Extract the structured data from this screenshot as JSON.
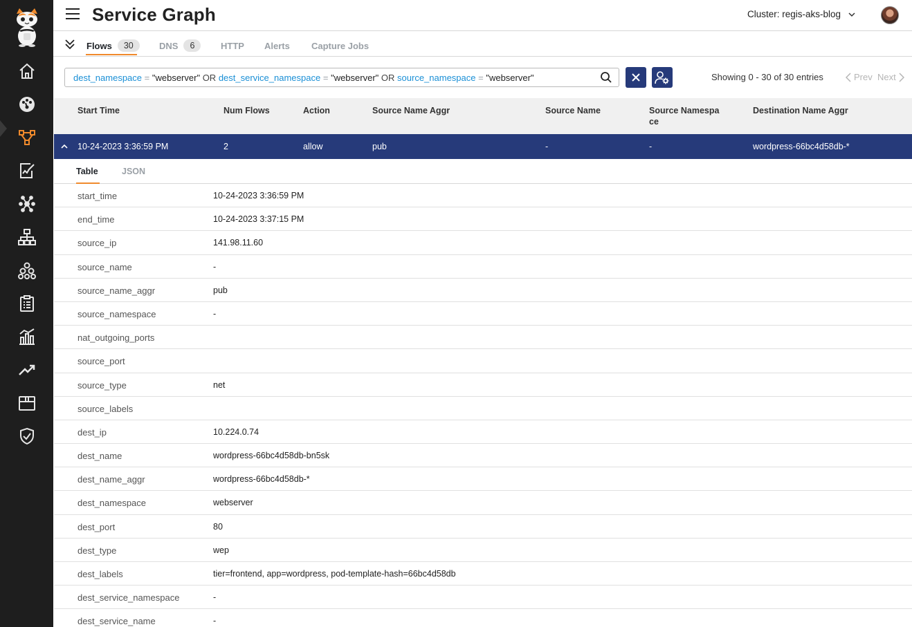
{
  "app": {
    "title": "Service Graph",
    "cluster_label": "Cluster: regis-aks-blog"
  },
  "sidebar": {
    "items": [
      {
        "icon": "home-icon"
      },
      {
        "icon": "dashboard-gauge-icon"
      },
      {
        "icon": "service-graph-icon",
        "active": true
      },
      {
        "icon": "policy-edit-icon"
      },
      {
        "icon": "network-nodes-icon"
      },
      {
        "icon": "hierarchy-icon"
      },
      {
        "icon": "cluster-nodes-icon"
      },
      {
        "icon": "clipboard-icon"
      },
      {
        "icon": "bar-chart-icon"
      },
      {
        "icon": "trend-up-icon"
      },
      {
        "icon": "box-icon"
      },
      {
        "icon": "shield-check-icon"
      }
    ]
  },
  "tabs": [
    {
      "label": "Flows",
      "count": "30",
      "active": true
    },
    {
      "label": "DNS",
      "count": "6"
    },
    {
      "label": "HTTP"
    },
    {
      "label": "Alerts"
    },
    {
      "label": "Capture Jobs"
    }
  ],
  "query": {
    "k1": "dest_namespace",
    "op": "=",
    "v1": "\"webserver\"",
    "b1": "OR",
    "k2": "dest_service_namespace",
    "v2": "\"webserver\"",
    "b2": "OR",
    "k3": "source_namespace",
    "v3": "\"webserver\""
  },
  "pagination": {
    "showing": "Showing 0 - 30 of 30 entries",
    "prev": "Prev",
    "next": "Next"
  },
  "table": {
    "columns": [
      "Start Time",
      "Num Flows",
      "Action",
      "Source Name Aggr",
      "Source Name",
      "Source Namespa ce",
      "Destination Name Aggr"
    ],
    "selected_row": [
      "10-24-2023 3:36:59 PM",
      "2",
      "allow",
      "pub",
      "-",
      "-",
      "wordpress-66bc4d58db-*"
    ]
  },
  "detail": {
    "subtabs": [
      "Table",
      "JSON"
    ],
    "rows": [
      {
        "key": "start_time",
        "value": "10-24-2023 3:36:59 PM"
      },
      {
        "key": "end_time",
        "value": "10-24-2023 3:37:15 PM"
      },
      {
        "key": "source_ip",
        "value": "141.98.11.60"
      },
      {
        "key": "source_name",
        "value": "-"
      },
      {
        "key": "source_name_aggr",
        "value": "pub"
      },
      {
        "key": "source_namespace",
        "value": "-"
      },
      {
        "key": "nat_outgoing_ports",
        "value": ""
      },
      {
        "key": "source_port",
        "value": ""
      },
      {
        "key": "source_type",
        "value": "net"
      },
      {
        "key": "source_labels",
        "value": ""
      },
      {
        "key": "dest_ip",
        "value": "10.224.0.74"
      },
      {
        "key": "dest_name",
        "value": "wordpress-66bc4d58db-bn5sk"
      },
      {
        "key": "dest_name_aggr",
        "value": "wordpress-66bc4d58db-*"
      },
      {
        "key": "dest_namespace",
        "value": "webserver"
      },
      {
        "key": "dest_port",
        "value": "80"
      },
      {
        "key": "dest_type",
        "value": "wep"
      },
      {
        "key": "dest_labels",
        "value": "tier=frontend, app=wordpress, pod-template-hash=66bc4d58db"
      },
      {
        "key": "dest_service_namespace",
        "value": "-"
      },
      {
        "key": "dest_service_name",
        "value": "-"
      }
    ]
  }
}
